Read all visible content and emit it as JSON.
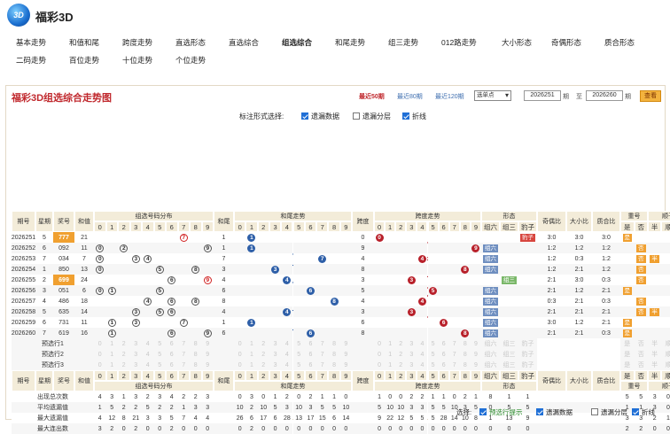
{
  "app": {
    "logo_text": "3D",
    "title": "福彩3D"
  },
  "nav": [
    "基本走势",
    "和值和尾",
    "跨度走势",
    "直选形态",
    "直选综合",
    "组选综合",
    "和尾走势",
    "组三走势",
    "012路走势",
    "大小形态",
    "奇偶形态",
    "质合形态",
    "二码走势",
    "百位走势",
    "十位走势",
    "个位走势"
  ],
  "nav_active": 5,
  "panel": {
    "title": "福彩3D组选综合走势图",
    "recent50": "最近50期",
    "recent80": "最近80期",
    "recent120": "最近120期",
    "select_label": "选单点",
    "from_value": "2026251",
    "from_suffix": "期",
    "to_label": "至",
    "to_value": "2026260",
    "to_suffix": "期",
    "query_btn": "查看"
  },
  "toggles": {
    "label": "标注形式选择:",
    "items": [
      {
        "label": "遗漏数据",
        "checked": true
      },
      {
        "label": "遗漏分层",
        "checked": false
      },
      {
        "label": "折线",
        "checked": true
      }
    ]
  },
  "header": {
    "period": "期号",
    "order": "星期",
    "award": "奖号",
    "sum": "和值",
    "dist_group": "组选号码分布",
    "sumtail": "和尾",
    "sumtail_trend": "和尾走势",
    "span": "跨度",
    "span_trend": "跨度走势",
    "form": "形态",
    "form_cols": [
      "组六",
      "组三",
      "豹子"
    ],
    "oddeven": "奇偶比",
    "bigsmall": "大小比",
    "primecomp": "质合比",
    "dup": "重号",
    "dup_cols": [
      "是",
      "否"
    ],
    "seq": "顺子",
    "seq_cols": [
      "半",
      "顺",
      "否"
    ],
    "digits": [
      "0",
      "1",
      "2",
      "3",
      "4",
      "5",
      "6",
      "7",
      "8",
      "9"
    ]
  },
  "rows": [
    {
      "period": "2026251",
      "week": "5",
      "award": "777",
      "sum": "21",
      "tail": "1",
      "span": "0",
      "form": "豹子",
      "oe": "3:0",
      "bs": "3:0",
      "pc": "3:0",
      "dup": "是",
      "seq": "否"
    },
    {
      "period": "2026252",
      "week": "6",
      "award": "092",
      "sum": "11",
      "tail": "1",
      "span": "9",
      "form": "组六",
      "oe": "1:2",
      "bs": "1:2",
      "pc": "1:2",
      "dup": "否",
      "seq": "否"
    },
    {
      "period": "2026253",
      "week": "7",
      "award": "034",
      "sum": "7",
      "tail": "7",
      "span": "4",
      "form": "组六",
      "oe": "1:2",
      "bs": "0:3",
      "pc": "1:2",
      "dup": "否",
      "seq": "半"
    },
    {
      "period": "2026254",
      "week": "1",
      "award": "850",
      "sum": "13",
      "tail": "3",
      "span": "8",
      "form": "组六",
      "oe": "1:2",
      "bs": "2:1",
      "pc": "1:2",
      "dup": "否",
      "seq": "否"
    },
    {
      "period": "2026255",
      "week": "2",
      "award": "699",
      "sum": "24",
      "tail": "4",
      "span": "3",
      "form": "组三",
      "oe": "2:1",
      "bs": "3:0",
      "pc": "0:3",
      "dup": "否",
      "seq": "否"
    },
    {
      "period": "2026256",
      "week": "3",
      "award": "051",
      "sum": "6",
      "tail": "6",
      "span": "5",
      "form": "组六",
      "oe": "2:1",
      "bs": "1:2",
      "pc": "2:1",
      "dup": "是",
      "seq": "否"
    },
    {
      "period": "2026257",
      "week": "4",
      "award": "486",
      "sum": "18",
      "tail": "8",
      "span": "4",
      "form": "组六",
      "oe": "0:3",
      "bs": "2:1",
      "pc": "0:3",
      "dup": "否",
      "seq": "否"
    },
    {
      "period": "2026258",
      "week": "5",
      "award": "635",
      "sum": "14",
      "tail": "4",
      "span": "3",
      "form": "组六",
      "oe": "2:1",
      "bs": "2:1",
      "pc": "2:1",
      "dup": "否",
      "seq": "半"
    },
    {
      "period": "2026259",
      "week": "6",
      "award": "731",
      "sum": "11",
      "tail": "1",
      "span": "6",
      "form": "组六",
      "oe": "3:0",
      "bs": "1:2",
      "pc": "2:1",
      "dup": "是",
      "seq": "否"
    },
    {
      "period": "2026260",
      "week": "7",
      "award": "619",
      "sum": "16",
      "tail": "6",
      "span": "8",
      "form": "组六",
      "oe": "2:1",
      "bs": "2:1",
      "pc": "0:3",
      "dup": "是",
      "seq": "否"
    }
  ],
  "presel": [
    "预选行1",
    "预选行2",
    "预选行3"
  ],
  "presel_forms": [
    "组六",
    "组三",
    "豹子"
  ],
  "presel_dup": [
    "是",
    "否"
  ],
  "presel_seq": [
    "半",
    "顺",
    "否"
  ],
  "footer_hdr": {
    "period": "期号",
    "week": "星期",
    "award": "奖号",
    "sum": "和值",
    "dist": "组选号码分布",
    "tail": "和尾",
    "tailtrend": "和尾走势",
    "span": "跨度",
    "spantrend": "跨度走势",
    "form": "形态",
    "oe": "奇偶比",
    "bs": "大小比",
    "pc": "质合比",
    "dup": "重号",
    "seq": "顺子"
  },
  "stats": [
    {
      "label": "出现总次数",
      "dist": [
        "4",
        "3",
        "1",
        "3",
        "2",
        "3",
        "4",
        "2",
        "2",
        "3"
      ],
      "tail": [
        "0",
        "3",
        "0",
        "1",
        "2",
        "0",
        "2",
        "1",
        "1",
        "0"
      ],
      "span": [
        "1",
        "0",
        "0",
        "2",
        "2",
        "1",
        "1",
        "0",
        "2",
        "1"
      ],
      "form": [
        "8",
        "1",
        "1"
      ],
      "dup": [
        "5",
        "5"
      ],
      "seq": [
        "3",
        "0",
        "7"
      ]
    },
    {
      "label": "平均遗漏值",
      "dist": [
        "1",
        "5",
        "2",
        "2",
        "5",
        "2",
        "2",
        "1",
        "3",
        "3"
      ],
      "tail": [
        "10",
        "2",
        "10",
        "5",
        "3",
        "10",
        "3",
        "5",
        "5",
        "10"
      ],
      "span": [
        "5",
        "10",
        "10",
        "3",
        "3",
        "5",
        "5",
        "10",
        "3",
        "5"
      ],
      "form": [
        "0",
        "5",
        "5"
      ],
      "dup": [
        "1",
        "1"
      ],
      "seq": [
        "3",
        "0",
        "1"
      ]
    },
    {
      "label": "最大遗漏值",
      "dist": [
        "4",
        "12",
        "8",
        "21",
        "3",
        "3",
        "5",
        "7",
        "4",
        "4"
      ],
      "tail": [
        "26",
        "6",
        "17",
        "6",
        "28",
        "13",
        "17",
        "15",
        "6",
        "14"
      ],
      "span": [
        "9",
        "22",
        "12",
        "5",
        "5",
        "5",
        "28",
        "14",
        "10",
        "8"
      ],
      "form": [
        "1",
        "13",
        "9"
      ],
      "dup": [
        "3",
        "3"
      ],
      "seq": [
        "2",
        "1",
        "12"
      ]
    },
    {
      "label": "最大连出数",
      "dist": [
        "3",
        "2",
        "0",
        "2",
        "0",
        "0",
        "2",
        "0",
        "0",
        "0"
      ],
      "tail": [
        "0",
        "2",
        "0",
        "0",
        "0",
        "0",
        "0",
        "0",
        "0",
        "0"
      ],
      "span": [
        "0",
        "0",
        "0",
        "0",
        "0",
        "0",
        "0",
        "0",
        "0",
        "0"
      ],
      "form": [
        "0",
        "0",
        "0"
      ],
      "dup": [
        "2",
        "2"
      ],
      "seq": [
        "0",
        "0",
        "2"
      ]
    }
  ],
  "footer": {
    "label": "选择:",
    "items": [
      {
        "label": "预选行提示",
        "checked": true,
        "green": true
      },
      {
        "label": "遗漏数据",
        "checked": true
      },
      {
        "label": "遗漏分层",
        "checked": false
      },
      {
        "label": "折线",
        "checked": true
      }
    ]
  },
  "colors": {
    "accent": "#c0282d",
    "header_bg": "#f3ecd9",
    "blue_dot": "#2e5fa8",
    "red_dot": "#b8202a",
    "query": "#f3b33e"
  }
}
